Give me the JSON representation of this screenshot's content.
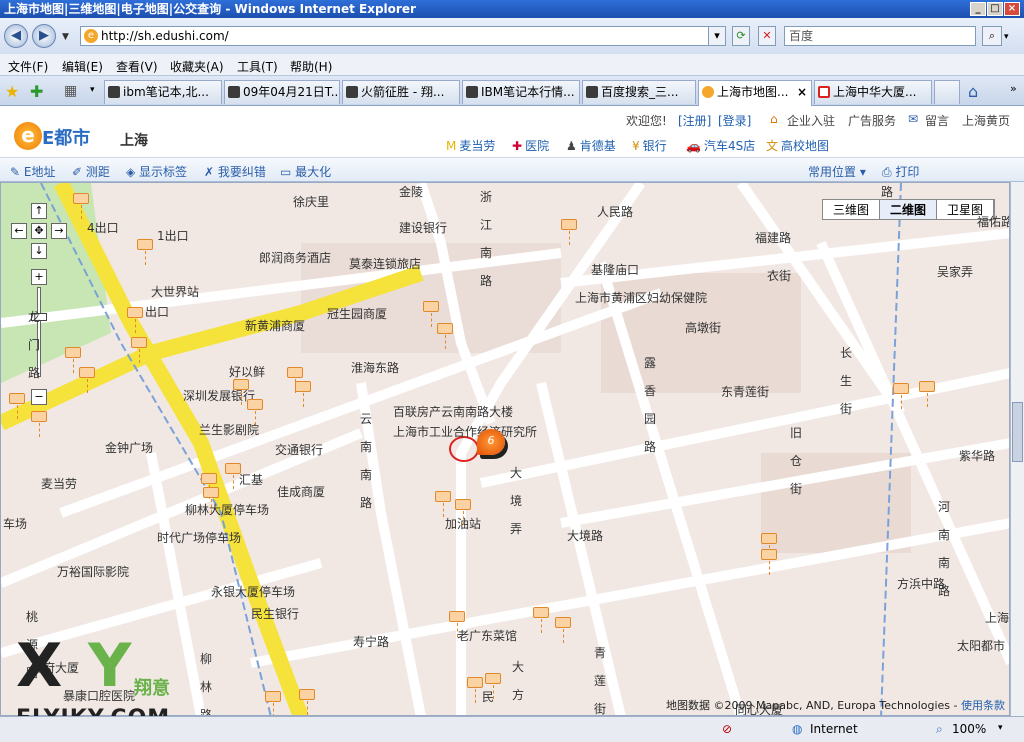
{
  "window": {
    "title": "上海市地图|三维地图|电子地图|公交查询 - Windows Internet Explorer"
  },
  "address": {
    "url": "http://sh.edushi.com/",
    "search_placeholder": "百度"
  },
  "menu": [
    "文件(F)",
    "编辑(E)",
    "查看(V)",
    "收藏夹(A)",
    "工具(T)",
    "帮助(H)"
  ],
  "tabs": [
    "ibm笔记本,北...",
    "09年04月21日T...",
    "火箭征胜 - 翔...",
    "IBM笔记本行情...",
    "百度搜索_三...",
    "上海市地图...",
    "上海中华大厦..."
  ],
  "site": {
    "logo": "E都市",
    "city": "上海",
    "welcome": "欢迎您!",
    "register": "[注册]",
    "login": "[登录]",
    "links": [
      "企业入驻",
      "广告服务",
      "留言",
      "上海黄页"
    ],
    "categories": [
      "麦当劳",
      "医院",
      "肯德基",
      "银行",
      "汽车4S店",
      "高校地图"
    ]
  },
  "tools": [
    "E地址",
    "测距",
    "显示标签",
    "我要纠错",
    "最大化"
  ],
  "tools_right": {
    "common": "常用位置",
    "print": "打印"
  },
  "map_types": [
    "三维图",
    "二维图",
    "卫星图"
  ],
  "map_labels": {
    "xuqingli": "徐庆里",
    "jianshe": "建设银行",
    "chukou4": "4出口",
    "chukou1": "1出口",
    "langrun": "郎润商务酒店",
    "motai": "莫泰连锁旅店",
    "jilong": "基隆庙口",
    "fuyou": "上海市黄浦区妇幼保健院",
    "dashijie": "大世界站",
    "chukou": "出口",
    "guansheng": "冠生园商厦",
    "xinhuangpu": "新黄浦商厦",
    "hao": "好以鲜",
    "shenzhen": "深圳发展银行",
    "bailian": "百联房产云南南路大楼",
    "gongye": "上海市工业合作经济研究所",
    "lansheng": "兰生影剧院",
    "jiaotong": "交通银行",
    "jinzhong": "金钟广场",
    "jiacheng": "佳成商厦",
    "maidanglao": "麦当劳",
    "huibang": "汇基",
    "liulin": "柳林大厦停车场",
    "jiayou": "加油站",
    "shidai": "时代广场停车场",
    "wanyu": "万裕国际影院",
    "yongyin": "永银大厦停车场",
    "minsheng": "民生银行",
    "laoguangdong": "老广东菜馆",
    "tongxin": "同心大厦",
    "taiyang": "太阳都市",
    "shanghaizhong": "上海",
    "fuyoukou": "福佑路",
    "baofeng": "暴康口腔医院",
    "huanghe": "王府大厦",
    "chang": "车场"
  },
  "road_labels": {
    "jinling": "金陵",
    "zhejiang": "浙江南路",
    "renmin": "人民路",
    "fujian": "福建路",
    "yiyi": "衣街",
    "wujia": "吴家弄",
    "huaihai": "淮海东路",
    "gaodun": "高墩街",
    "luxiang": "露香园路",
    "donghe": "东青莲街",
    "changsheng": "长生街",
    "yunnan": "云南南路",
    "jiucang": "旧仓街",
    "zihua": "紫华路",
    "dajing": "大境弄",
    "dajinglu": "大境路",
    "henan": "河南南路",
    "fangbin": "方浜中路",
    "taoyuan": "桃源路",
    "shouning": "寿宁路",
    "liulinlu": "柳林路",
    "dafang": "大方弄",
    "qinglian": "青莲街",
    "minsheng": "民胜",
    "longmen": "龙门路",
    "lu": "路",
    "fuyou": "福佑路"
  },
  "marker": {
    "label": "6"
  },
  "copyright": {
    "text": "地图数据 ©2009 Mapabc, AND, Europa Technologies -",
    "link": "使用条款"
  },
  "statusbar": {
    "zone": "Internet",
    "zoom": "100%"
  },
  "watermark": {
    "x": "X",
    "y": "Y",
    "zh": "翔意",
    "domain": "FLYIKY.COM"
  },
  "colors": {
    "titlebar": "#1d4fb0",
    "major_road": "#f5e23a",
    "minor_road": "#ffffff",
    "map_bg": "#f1e8e4",
    "park": "#c8e6b4",
    "accent": "#f07c00"
  }
}
